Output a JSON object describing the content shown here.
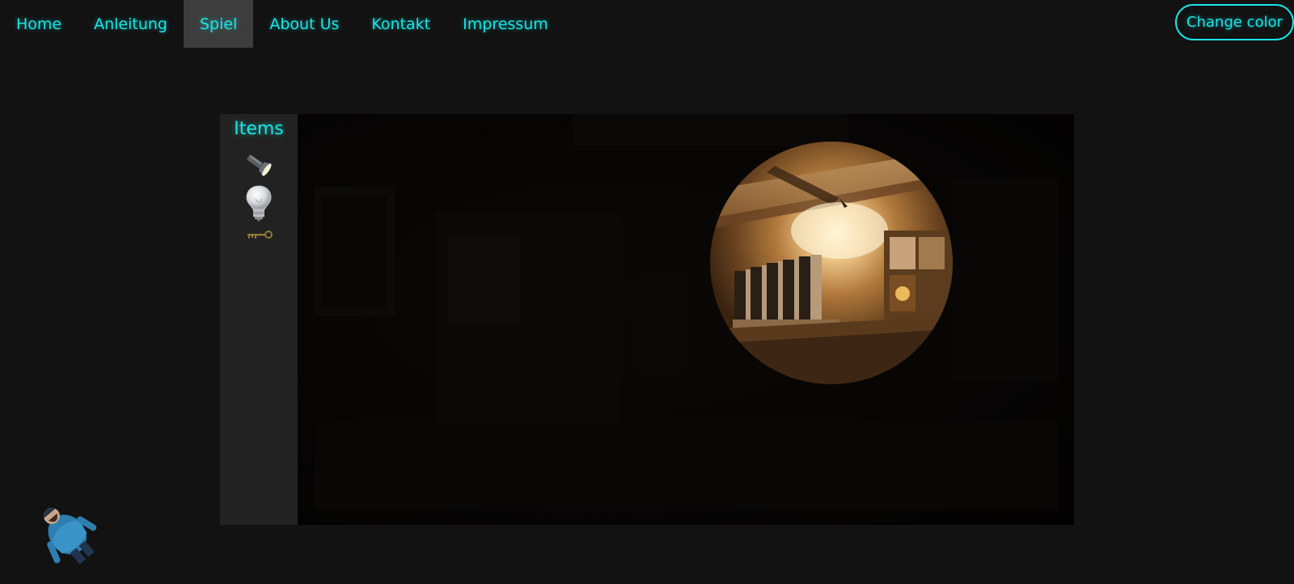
{
  "nav": {
    "items": [
      {
        "label": "Home",
        "active": false
      },
      {
        "label": "Anleitung",
        "active": false
      },
      {
        "label": "Spiel",
        "active": true
      },
      {
        "label": "About Us",
        "active": false
      },
      {
        "label": "Kontakt",
        "active": false
      },
      {
        "label": "Impressum",
        "active": false
      }
    ]
  },
  "header": {
    "change_color_label": "Change color"
  },
  "game": {
    "items_title": "Items",
    "items": [
      {
        "icon": "flashlight-icon"
      },
      {
        "icon": "lightbulb-icon"
      },
      {
        "icon": "key-icon"
      }
    ],
    "scene_image": "dark-room-with-flashlight-spot",
    "player_icon": "player-character-icon"
  },
  "colors": {
    "accent": "#19e6e6",
    "background": "#121212",
    "panel": "#222222",
    "active_tab": "#3d3d3d"
  }
}
